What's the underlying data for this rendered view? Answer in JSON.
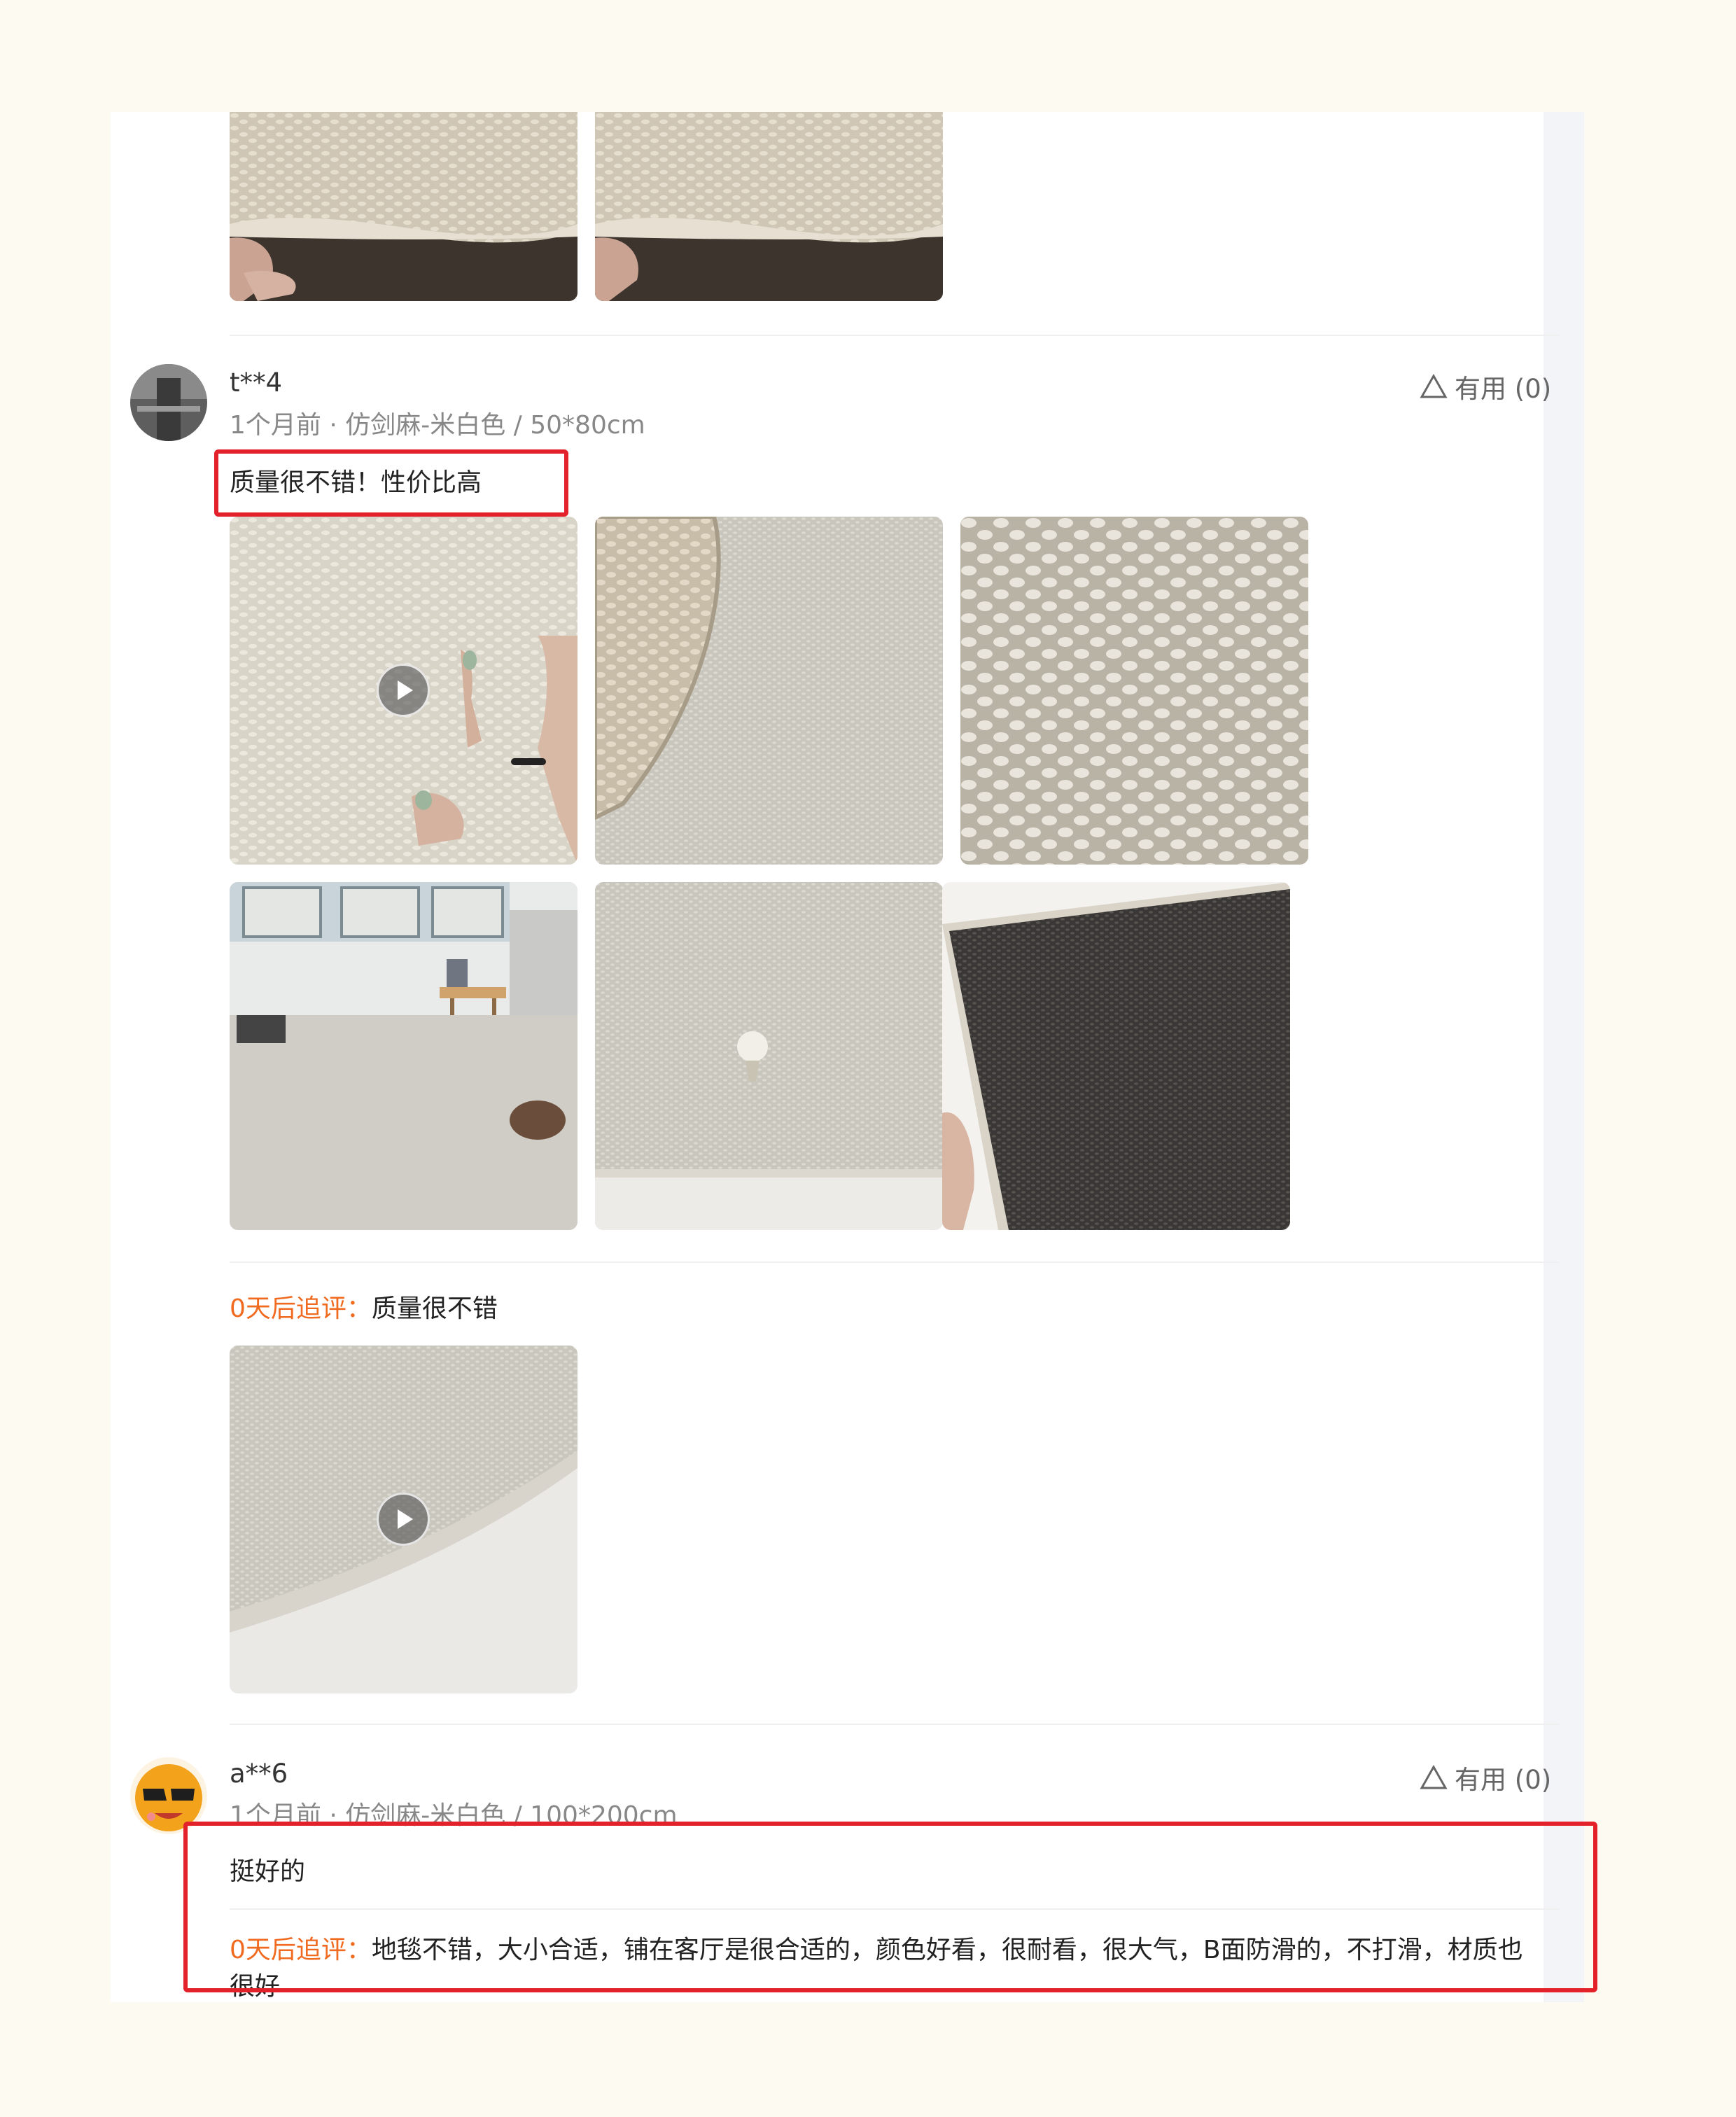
{
  "reviews": [
    {
      "user": "t**4",
      "meta": "1个月前 · 仿剑麻-米白色 / 50*80cm",
      "text": "质量很不错！性价比高",
      "helpful": "有用 (0)",
      "follow_up_label": "0天后追评：",
      "follow_up_text": "质量很不错"
    },
    {
      "user": "a**6",
      "meta": "1个月前 · 仿剑麻-米白色 / 100*200cm",
      "text": "挺好的",
      "helpful": "有用 (0)",
      "follow_up_label": "0天后追评：",
      "follow_up_text": "地毯不错，大小合适，铺在客厅是很合适的，颜色好看，很耐看，很大气，B面防滑的，不打滑，材质也很好"
    }
  ],
  "icons": {
    "helpful": "triangle-outline-icon",
    "video": "play-icon"
  },
  "colors": {
    "follow_up_label": "#f06a1f",
    "highlight_box": "#e2212b",
    "background": "#fdfaf2"
  }
}
